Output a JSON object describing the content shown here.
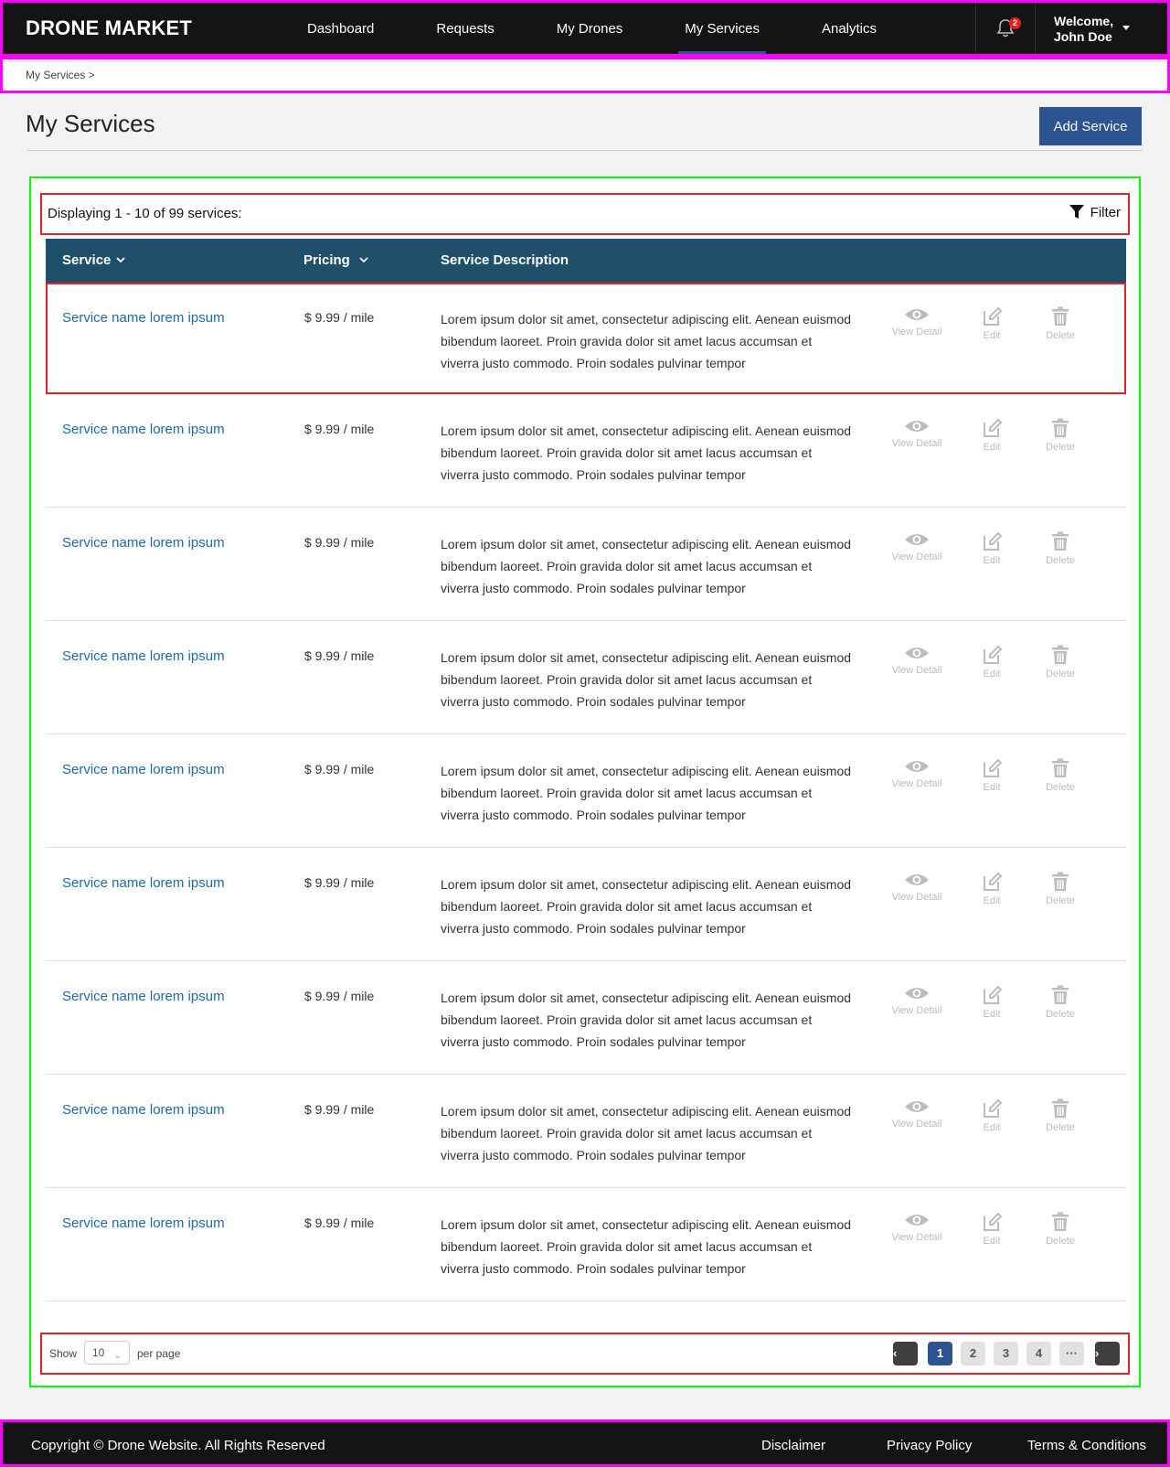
{
  "header": {
    "logo": "DRONE MARKET",
    "nav": [
      "Dashboard",
      "Requests",
      "My Drones",
      "My Services",
      "Analytics"
    ],
    "active_nav": "My Services",
    "notifications_count": "2",
    "welcome": "Welcome,",
    "user_name": "John Doe"
  },
  "breadcrumb": {
    "item": "My Services  >"
  },
  "page": {
    "title": "My Services",
    "add_button": "Add Service"
  },
  "listing": {
    "info": "Displaying 1 - 10 of 99 services:",
    "filter_label": "Filter",
    "columns": {
      "service": "Service",
      "pricing": "Pricing",
      "description": "Service Description"
    },
    "action_labels": {
      "view": "View Detail",
      "edit": "Edit",
      "delete": "Delete"
    },
    "rows": [
      {
        "name": "Service name lorem ipsum",
        "price": "$ 9.99 / mile",
        "description": "Lorem ipsum dolor sit amet, consectetur adipiscing elit. Aenean euismod bibendum laoreet. Proin gravida dolor sit amet lacus accumsan et viverra justo commodo. Proin sodales pulvinar tempor"
      },
      {
        "name": "Service name lorem ipsum",
        "price": "$ 9.99 / mile",
        "description": "Lorem ipsum dolor sit amet, consectetur adipiscing elit. Aenean euismod bibendum laoreet. Proin gravida dolor sit amet lacus accumsan et viverra justo commodo. Proin sodales pulvinar tempor"
      },
      {
        "name": "Service name lorem ipsum",
        "price": "$ 9.99 / mile",
        "description": "Lorem ipsum dolor sit amet, consectetur adipiscing elit. Aenean euismod bibendum laoreet. Proin gravida dolor sit amet lacus accumsan et viverra justo commodo. Proin sodales pulvinar tempor"
      },
      {
        "name": "Service name lorem ipsum",
        "price": "$ 9.99 / mile",
        "description": "Lorem ipsum dolor sit amet, consectetur adipiscing elit. Aenean euismod bibendum laoreet. Proin gravida dolor sit amet lacus accumsan et viverra justo commodo. Proin sodales pulvinar tempor"
      },
      {
        "name": "Service name lorem ipsum",
        "price": "$ 9.99 / mile",
        "description": "Lorem ipsum dolor sit amet, consectetur adipiscing elit. Aenean euismod bibendum laoreet. Proin gravida dolor sit amet lacus accumsan et viverra justo commodo. Proin sodales pulvinar tempor"
      },
      {
        "name": "Service name lorem ipsum",
        "price": "$ 9.99 / mile",
        "description": "Lorem ipsum dolor sit amet, consectetur adipiscing elit. Aenean euismod bibendum laoreet. Proin gravida dolor sit amet lacus accumsan et viverra justo commodo. Proin sodales pulvinar tempor"
      },
      {
        "name": "Service name lorem ipsum",
        "price": "$ 9.99 / mile",
        "description": "Lorem ipsum dolor sit amet, consectetur adipiscing elit. Aenean euismod bibendum laoreet. Proin gravida dolor sit amet lacus accumsan et viverra justo commodo. Proin sodales pulvinar tempor"
      },
      {
        "name": "Service name lorem ipsum",
        "price": "$ 9.99 / mile",
        "description": "Lorem ipsum dolor sit amet, consectetur adipiscing elit. Aenean euismod bibendum laoreet. Proin gravida dolor sit amet lacus accumsan et viverra justo commodo. Proin sodales pulvinar tempor"
      },
      {
        "name": "Service name lorem ipsum",
        "price": "$ 9.99 / mile",
        "description": "Lorem ipsum dolor sit amet, consectetur adipiscing elit. Aenean euismod bibendum laoreet. Proin gravida dolor sit amet lacus accumsan et viverra justo commodo. Proin sodales pulvinar tempor"
      }
    ]
  },
  "pagination": {
    "show_label": "Show",
    "per_page_value": "10",
    "per_page_label": "per page",
    "prev": "‹",
    "next": "›",
    "pages": [
      "1",
      "2",
      "3",
      "4",
      "···"
    ],
    "current_page": "1"
  },
  "footer": {
    "copyright": "Copyright © Drone Website. All Rights Reserved",
    "links": [
      "Disclaimer",
      "Privacy Policy",
      "Terms & Conditions"
    ]
  },
  "colors": {
    "header_bg": "#141414",
    "accent": "#2b5490",
    "table_header": "#1f4f6b",
    "link": "#1d6aa8",
    "action_icon": "#b9bcc2"
  },
  "icons": [
    "bell-icon",
    "caret-down-icon",
    "filter-icon",
    "chevron-down-icon",
    "eye-icon",
    "edit-icon",
    "trash-icon"
  ]
}
